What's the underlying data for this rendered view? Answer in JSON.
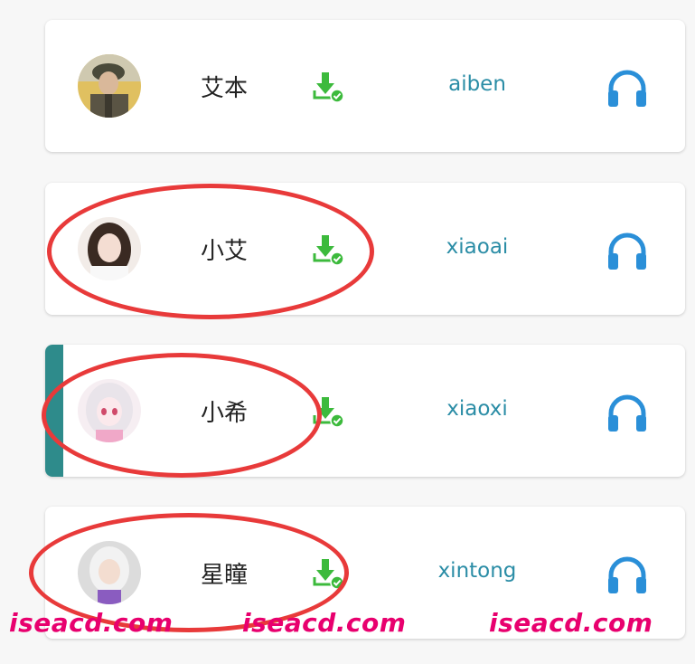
{
  "voices": [
    {
      "name": "艾本",
      "id": "aiben",
      "selected": false,
      "avatar": "avatar-soldier",
      "download_icon": "download-check-icon",
      "listen_icon": "headphones-icon"
    },
    {
      "name": "小艾",
      "id": "xiaoai",
      "selected": false,
      "avatar": "avatar-girl",
      "download_icon": "download-check-icon",
      "listen_icon": "headphones-icon"
    },
    {
      "name": "小希",
      "id": "xiaoxi",
      "selected": true,
      "avatar": "avatar-anime-girl",
      "download_icon": "download-check-icon",
      "listen_icon": "headphones-icon"
    },
    {
      "name": "星瞳",
      "id": "xintong",
      "selected": false,
      "avatar": "avatar-3d-girl",
      "download_icon": "download-check-icon",
      "listen_icon": "headphones-icon"
    }
  ],
  "watermarks": [
    "iseacd.com",
    "iseacd.com",
    "iseacd.com"
  ],
  "colors": {
    "voice_id": "#2b8da6",
    "download_icon": "#3cba3c",
    "headphones": "#2a8fd8",
    "selected_bar": "#2e8b8b",
    "annotation": "#e83a3a",
    "watermark": "#e8006e"
  }
}
